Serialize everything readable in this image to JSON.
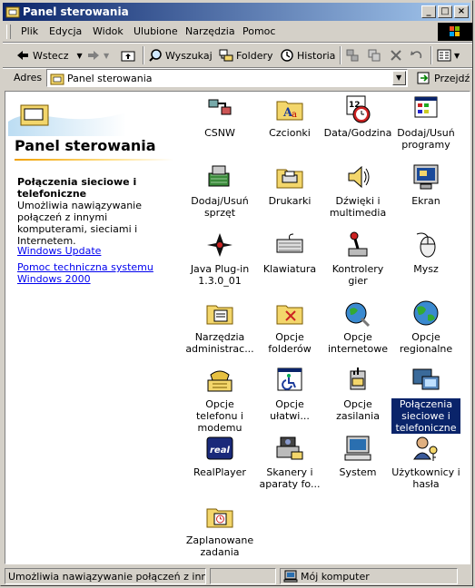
{
  "window": {
    "title": "Panel sterowania"
  },
  "menu": [
    "Plik",
    "Edycja",
    "Widok",
    "Ulubione",
    "Narzędzia",
    "Pomoc"
  ],
  "toolbar": {
    "back": "Wstecz",
    "search": "Wyszukaj",
    "folders": "Foldery",
    "history": "Historia"
  },
  "address": {
    "label": "Adres",
    "value": "Panel sterowania",
    "go": "Przejdź"
  },
  "sidebar": {
    "header": "Panel sterowania",
    "desc_title": "Połączenia sieciowe i telefoniczne",
    "desc_text": "Umożliwia nawiązywanie połączeń z innymi komputerami, sieciami i Internetem.",
    "links": [
      "Windows Update",
      "Pomoc techniczna systemu Windows 2000"
    ]
  },
  "icons": [
    {
      "label": "CSNW",
      "icon": "network-client-icon"
    },
    {
      "label": "Czcionki",
      "icon": "fonts-folder-icon"
    },
    {
      "label": "Data/Godzina",
      "icon": "calendar-clock-icon"
    },
    {
      "label": "Dodaj/Usuń programy",
      "icon": "add-remove-programs-icon"
    },
    {
      "label": "Dodaj/Usuń sprzęt",
      "icon": "add-hardware-icon"
    },
    {
      "label": "Drukarki",
      "icon": "printers-folder-icon"
    },
    {
      "label": "Dźwięki i multimedia",
      "icon": "speaker-icon"
    },
    {
      "label": "Ekran",
      "icon": "display-icon"
    },
    {
      "label": "Java Plug-in 1.3.0_01",
      "icon": "java-icon"
    },
    {
      "label": "Klawiatura",
      "icon": "keyboard-icon"
    },
    {
      "label": "Kontrolery gier",
      "icon": "joystick-icon"
    },
    {
      "label": "Mysz",
      "icon": "mouse-icon"
    },
    {
      "label": "Narzędzia administrac...",
      "icon": "admin-tools-icon"
    },
    {
      "label": "Opcje folderów",
      "icon": "folder-options-icon"
    },
    {
      "label": "Opcje internetowe",
      "icon": "internet-options-icon"
    },
    {
      "label": "Opcje regionalne",
      "icon": "globe-icon"
    },
    {
      "label": "Opcje telefonu i modemu",
      "icon": "phone-icon"
    },
    {
      "label": "Opcje ułatwi...",
      "icon": "accessibility-icon"
    },
    {
      "label": "Opcje zasilania",
      "icon": "power-icon"
    },
    {
      "label": "Połączenia sieciowe i telefoniczne",
      "icon": "network-connections-icon"
    },
    {
      "label": "RealPlayer",
      "icon": "realplayer-icon"
    },
    {
      "label": "Skanery i aparaty fo...",
      "icon": "scanner-camera-icon"
    },
    {
      "label": "System",
      "icon": "computer-icon"
    },
    {
      "label": "Użytkownicy i hasła",
      "icon": "users-keys-icon"
    },
    {
      "label": "Zaplanowane zadania",
      "icon": "scheduled-tasks-icon"
    }
  ],
  "statusbar": {
    "text": "Umożliwia nawiązywanie połączeń z innymi komputerami, sieciami i Internetem.",
    "zone": "Mój komputer"
  }
}
